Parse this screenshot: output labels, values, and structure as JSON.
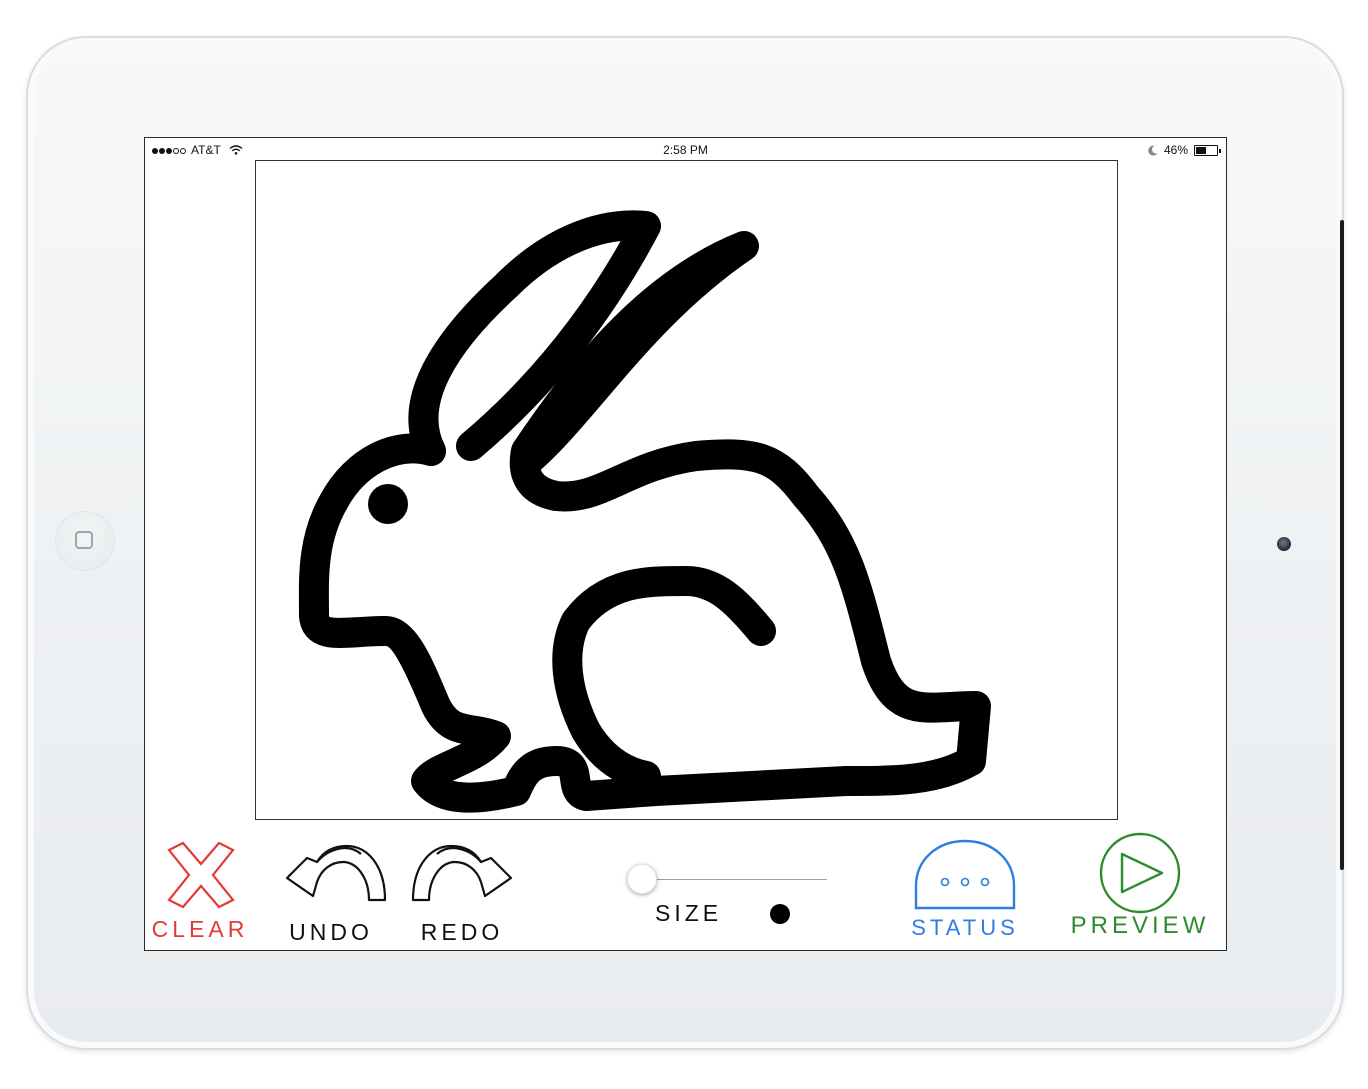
{
  "status_bar": {
    "signal_bars_total": 5,
    "signal_bars_filled": 3,
    "carrier": "AT&T",
    "time": "2:58 PM",
    "battery_percent": "46%",
    "battery_level": 0.46,
    "icons": [
      "wifi-icon",
      "moon-icon",
      "battery-icon"
    ]
  },
  "canvas": {
    "drawing": "bunny-outline-sketch",
    "stroke_color": "#000000"
  },
  "toolbar": {
    "clear_label": "CLEAR",
    "undo_label": "UNDO",
    "redo_label": "REDO",
    "size_label": "SIZE",
    "status_label": "STATUS",
    "preview_label": "PREVIEW",
    "size_slider_value": 0.0,
    "colors": {
      "clear": "#e53935",
      "status": "#2f7de1",
      "preview": "#2e8b2e",
      "default": "#111111"
    }
  }
}
